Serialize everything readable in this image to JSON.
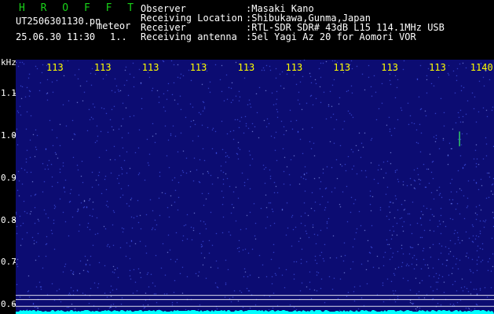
{
  "header": {
    "title": "H R O F F T",
    "file": "UT2506301130.pn",
    "tag": "meteor",
    "datetime": "25.06.30 11:30",
    "count": "1.."
  },
  "info": [
    {
      "key": "Observer",
      "value": ":Masaki Kano"
    },
    {
      "key": "Receiving Location",
      "value": ":Shibukawa,Gunma,Japan"
    },
    {
      "key": "Receiver",
      "value": ":RTL-SDR SDR# 43dB L15 114.1MHz USB"
    },
    {
      "key": "Receiving antenna",
      "value": ":5el Yagi Az 20 for Aomori VOR"
    }
  ],
  "colors": {
    "title": "#19d219",
    "text": "#ffffff",
    "time_ticks": "#ffff00",
    "background": "#0c0c72",
    "noise_dots": "#4b63ff",
    "power_trace": "#00ffff",
    "echo": "#33cc66",
    "guide_lines": "#ffffff"
  },
  "chart_data": {
    "type": "heatmap",
    "ylabel": "kHz",
    "y_ticks": [
      "1.1",
      "1.0",
      "0.9",
      "0.8",
      "0.7",
      "0.6"
    ],
    "y_values": [
      1.1,
      1.0,
      0.9,
      0.8,
      0.7,
      0.6
    ],
    "ylim": [
      0.578,
      1.18
    ],
    "x_ticks": [
      "113",
      "113",
      "113",
      "113",
      "113",
      "113",
      "113",
      "113",
      "113",
      "1140"
    ],
    "x_tick_minutes": [
      1,
      2,
      3,
      4,
      5,
      6,
      7,
      8,
      9,
      10
    ],
    "xlim": [
      0.0,
      10.0
    ],
    "guide_lines_khz": [
      0.623,
      0.613,
      0.597
    ],
    "echoes": [
      {
        "minute": 9.28,
        "khz_from": 1.01,
        "khz_to": 0.975
      }
    ]
  }
}
